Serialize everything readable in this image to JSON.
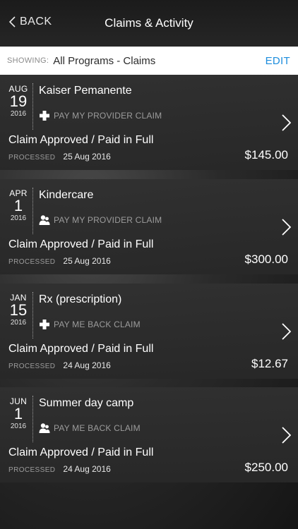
{
  "nav": {
    "back_label": "BACK",
    "title": "Claims & Activity"
  },
  "filter": {
    "showing_label": "SHOWING:",
    "showing_value": "All Programs - Claims",
    "edit_label": "EDIT"
  },
  "claims": [
    {
      "month": "AUG",
      "day": "19",
      "year": "2016",
      "provider": "Kaiser Pemanente",
      "type_icon": "plus-icon",
      "type": "PAY MY PROVIDER CLAIM",
      "status": "Claim Approved / Paid in Full",
      "processed_label": "PROCESSED",
      "processed_date": "25 Aug 2016",
      "amount": "$145.00"
    },
    {
      "month": "APR",
      "day": "1",
      "year": "2016",
      "provider": "Kindercare",
      "type_icon": "person-icon",
      "type": "PAY MY PROVIDER CLAIM",
      "status": "Claim Approved / Paid in Full",
      "processed_label": "PROCESSED",
      "processed_date": "25 Aug 2016",
      "amount": "$300.00"
    },
    {
      "month": "JAN",
      "day": "15",
      "year": "2016",
      "provider": "Rx (prescription)",
      "type_icon": "plus-icon",
      "type": "PAY ME BACK CLAIM",
      "status": "Claim Approved / Paid in Full",
      "processed_label": "PROCESSED",
      "processed_date": "24 Aug 2016",
      "amount": "$12.67"
    },
    {
      "month": "JUN",
      "day": "1",
      "year": "2016",
      "provider": "Summer day camp",
      "type_icon": "person-icon",
      "type": "PAY ME BACK CLAIM",
      "status": "Claim Approved / Paid in Full",
      "processed_label": "PROCESSED",
      "processed_date": "24 Aug 2016",
      "amount": "$250.00"
    }
  ]
}
